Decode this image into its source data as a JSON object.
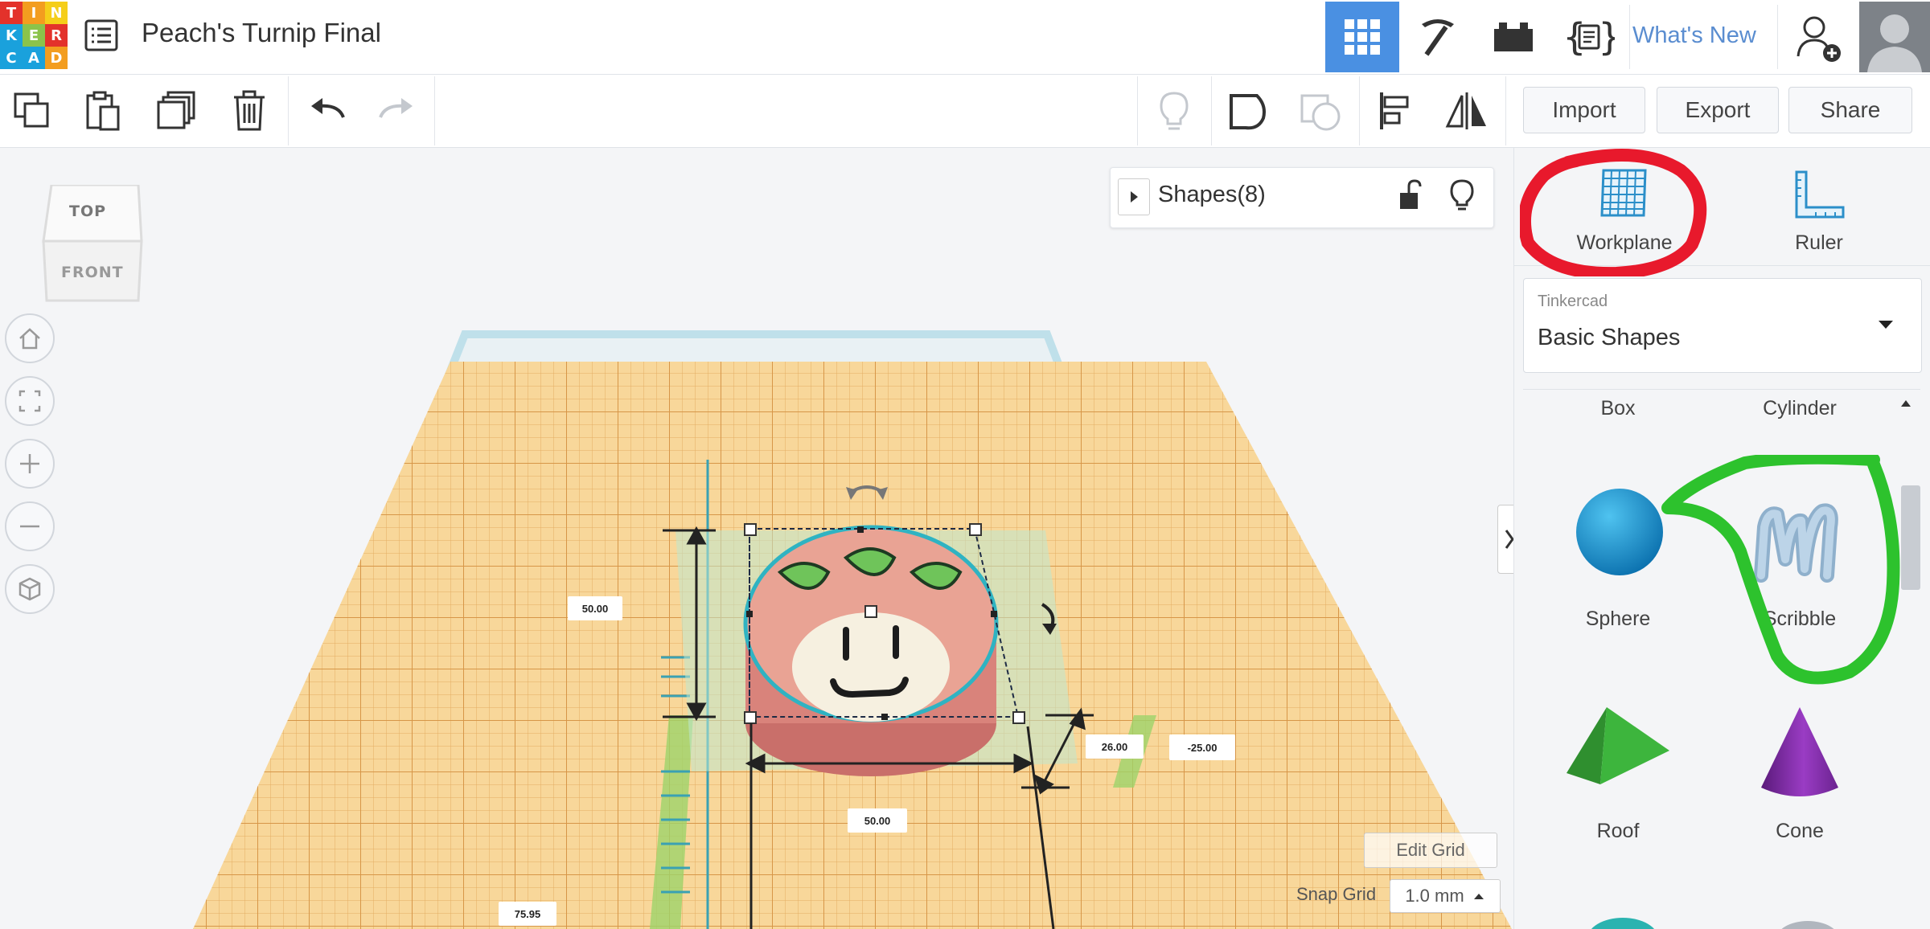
{
  "app": {
    "logo_letters": [
      "T",
      "I",
      "N",
      "K",
      "E",
      "R",
      "C",
      "A",
      "D"
    ],
    "logo_colors": [
      "#e3322b",
      "#f39d1f",
      "#f5ce1a",
      "#1aa1dc",
      "#8bc34a",
      "#e3322b",
      "#1aa1dc",
      "#1aa1dc",
      "#f39d1f"
    ],
    "document_title": "Peach's Turnip Final",
    "accent_color": "#4a90e2"
  },
  "topbar": {
    "buttons": [
      "3d-design-view",
      "blocks-view",
      "bricks-view",
      "codeblocks-view"
    ],
    "whats_new": "What's New"
  },
  "toolbar": {
    "import": "Import",
    "export": "Export",
    "share": "Share"
  },
  "viewcube": {
    "top": "TOP",
    "front": "FRONT"
  },
  "shapes_panel": {
    "title": "Shapes(8)"
  },
  "rightpanel": {
    "workplane": "Workplane",
    "ruler": "Ruler",
    "library_label": "Tinkercad",
    "library_value": "Basic Shapes",
    "shapes": [
      "Box",
      "Cylinder",
      "Sphere",
      "Scribble",
      "Roof",
      "Cone"
    ]
  },
  "dimensions": {
    "height": "50.00",
    "width": "50.00",
    "depth": "26.00",
    "elevation": "-25.00",
    "offset": "75.95"
  },
  "grid": {
    "edit_grid": "Edit Grid",
    "snap_label": "Snap Grid",
    "snap_value": "1.0 mm"
  },
  "annotations": {
    "red_circle_color": "#e8192c",
    "green_circle_color": "#2dc22d"
  }
}
